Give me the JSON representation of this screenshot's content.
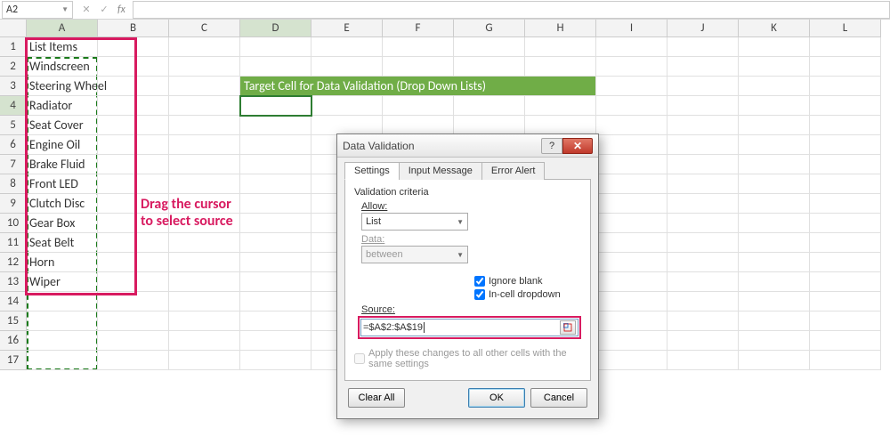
{
  "namebox": {
    "value": "A2"
  },
  "fx": {
    "cancel": "✕",
    "confirm": "✓",
    "fx_label": "fx"
  },
  "columns": [
    "A",
    "B",
    "C",
    "D",
    "E",
    "F",
    "G",
    "H",
    "I",
    "J",
    "K",
    "L"
  ],
  "rows": [
    1,
    2,
    3,
    4,
    5,
    6,
    7,
    8,
    9,
    10,
    11,
    12,
    13,
    14,
    15,
    16,
    17
  ],
  "cells": {
    "A1": "List Items",
    "A2": "Windscreen",
    "A3": "Steering Wheel",
    "A4": "Radiator",
    "A5": "Seat Cover",
    "A6": "Engine Oil",
    "A7": "Brake Fluid",
    "A8": "Front LED",
    "A9": "Clutch Disc",
    "A10": "Gear Box",
    "A11": "Seat Belt",
    "A12": "Horn",
    "A13": "Wiper"
  },
  "banner": {
    "text": "Target Cell for Data Validation (Drop Down Lists)"
  },
  "annotation": {
    "line1": "Drag the cursor",
    "line2": "to select source"
  },
  "dialog": {
    "title": "Data Validation",
    "tabs": {
      "settings": "Settings",
      "input_message": "Input Message",
      "error_alert": "Error Alert"
    },
    "criteria_label": "Validation criteria",
    "allow_label": "Allow:",
    "allow_value": "List",
    "data_label": "Data:",
    "data_value": "between",
    "ignore_blank": "Ignore blank",
    "incell_dd": "In-cell dropdown",
    "source_label": "Source:",
    "source_value": "=$A$2:$A$19",
    "apply_label": "Apply these changes to all other cells with the same settings",
    "clear_all": "Clear All",
    "ok": "OK",
    "cancel": "Cancel",
    "help": "?",
    "close": "✕"
  }
}
